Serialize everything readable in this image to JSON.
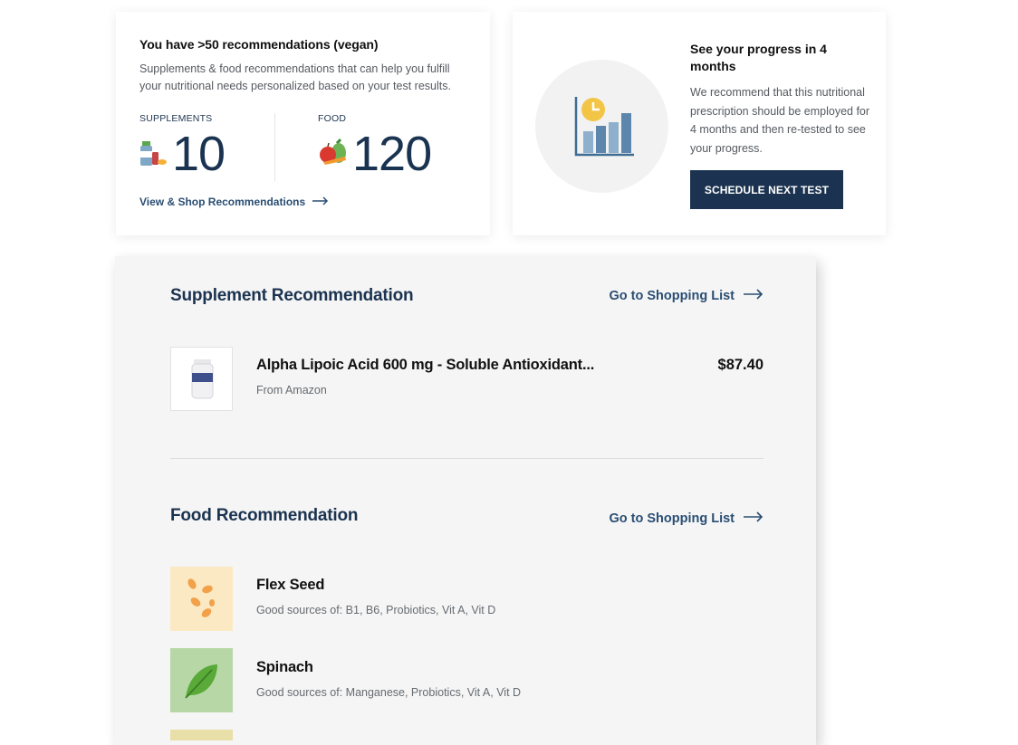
{
  "recs_card": {
    "title": "You have >50 recommendations (vegan)",
    "description": "Supplements & food recommendations that can help you fulfill your nutritional needs personalized based on your test results.",
    "supplements_label": "SUPPLEMENTS",
    "supplements_count": "10",
    "food_label": "FOOD",
    "food_count": "120",
    "link_label": "View & Shop Recommendations"
  },
  "progress_card": {
    "title": "See your progress in 4 months",
    "description": "We recommend that this nutritional prescription should be employed for 4 months and then re-tested to see your progress.",
    "button_label": "SCHEDULE NEXT TEST"
  },
  "supplement_section": {
    "title": "Supplement Recommendation",
    "link_label": "Go to Shopping List",
    "items": [
      {
        "name": "Alpha Lipoic Acid 600 mg - Soluble Antioxidant...",
        "source": "From Amazon",
        "price": "$87.40"
      }
    ]
  },
  "food_section": {
    "title": "Food Recommendation",
    "link_label": "Go to Shopping List",
    "items": [
      {
        "name": "Flex Seed",
        "sources": "Good sources of: B1, B6, Probiotics, Vit A, Vit D",
        "thumb_color": "#fbe9c3"
      },
      {
        "name": "Spinach",
        "sources": "Good sources of: Manganese, Probiotics, Vit A, Vit D",
        "thumb_color": "#b7d8a6"
      }
    ]
  },
  "colors": {
    "navy": "#1b3350",
    "link": "#2a4e73",
    "panel_bg": "#f5f5f5"
  }
}
